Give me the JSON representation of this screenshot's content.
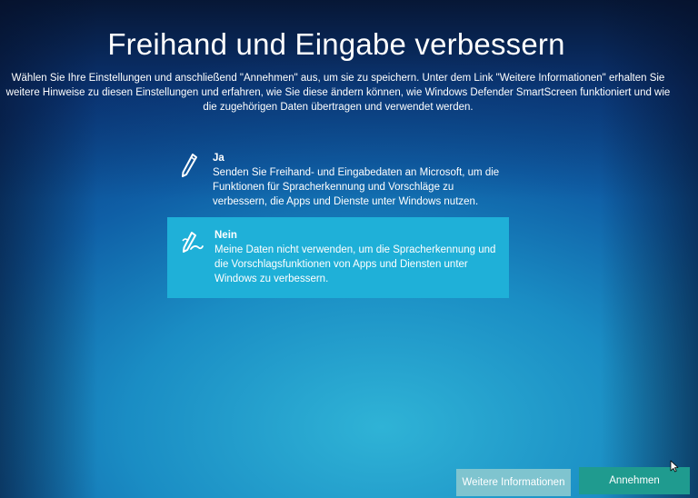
{
  "page": {
    "title": "Freihand und Eingabe verbessern",
    "intro": "Wählen Sie Ihre Einstellungen und anschließend \"Annehmen\" aus, um sie zu speichern. Unter dem Link \"Weitere Informationen\" erhalten Sie weitere Hinweise zu diesen Einstellungen und erfahren, wie Sie diese ändern können, wie Windows Defender SmartScreen funktioniert und wie die zugehörigen Daten übertragen und verwendet werden."
  },
  "options": [
    {
      "heading": "Ja",
      "description": "Senden Sie Freihand- und Eingabedaten an Microsoft, um die Funktionen für Spracherkennung und Vorschläge zu verbessern, die Apps und Dienste unter Windows nutzen.",
      "selected": false,
      "icon": "pen-icon"
    },
    {
      "heading": "Nein",
      "description": "Meine Daten nicht verwenden, um die Spracherkennung und die Vorschlagsfunktionen von Apps und Diensten unter Windows zu verbessern.",
      "selected": true,
      "icon": "pen-off-icon"
    }
  ],
  "buttons": {
    "more_info": "Weitere Informationen",
    "accept": "Annehmen"
  },
  "colors": {
    "selected_option": "#1fb0d8",
    "accept_button": "#1f9b8f",
    "more_info_button": "#7fc4cf"
  }
}
